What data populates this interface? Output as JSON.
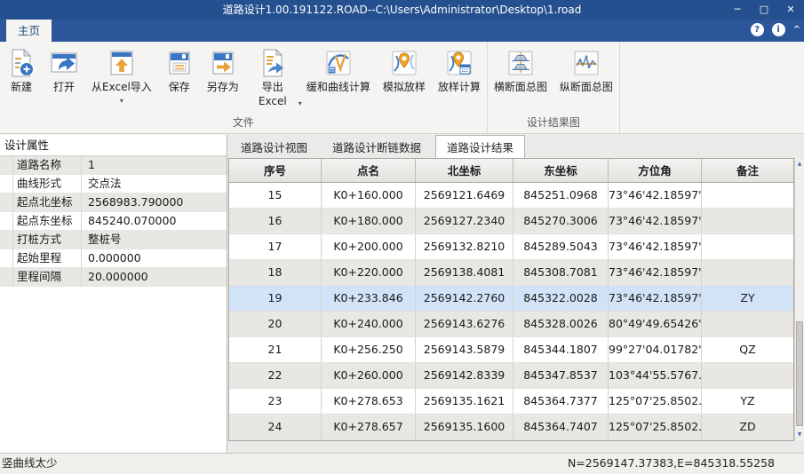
{
  "window": {
    "title": "道路设计1.00.191122.ROAD--C:\\Users\\Administrator\\Desktop\\1.road"
  },
  "icons": {
    "minimize": "─",
    "maximize": "□",
    "close": "✕",
    "help": "?",
    "info": "i",
    "collapse_ribbon": "^",
    "dropdown": "▾",
    "scroll_up": "▲",
    "scroll_down": "▼"
  },
  "colors": {
    "titlebar_blue": "#24508f",
    "ribbon_band_blue": "#2b579a",
    "selected_row": "#d2e3f8",
    "alt_row": "#e9e7e3",
    "accent_orange": "#e8a33d",
    "accent_blue": "#3a76c4"
  },
  "ribbon": {
    "tab": "主页",
    "groups": [
      {
        "label": "文件",
        "buttons": [
          {
            "label": "新建"
          },
          {
            "label": "打开"
          },
          {
            "label": "从Excel导入",
            "dropdown": true
          },
          {
            "label": "保存"
          },
          {
            "label": "另存为"
          },
          {
            "label": "导出Excel",
            "dropdown": true
          },
          {
            "label": "缓和曲线计算"
          },
          {
            "label": "模拟放样"
          },
          {
            "label": "放样计算"
          }
        ]
      },
      {
        "label": "设计结果图",
        "buttons": [
          {
            "label": "横断面总图"
          },
          {
            "label": "纵断面总图"
          }
        ]
      }
    ]
  },
  "properties": {
    "title": "设计属性",
    "rows": [
      {
        "label": "道路名称",
        "value": "1"
      },
      {
        "label": "曲线形式",
        "value": "交点法"
      },
      {
        "label": "起点北坐标",
        "value": "2568983.790000"
      },
      {
        "label": "起点东坐标",
        "value": "845240.070000"
      },
      {
        "label": "打桩方式",
        "value": "整桩号"
      },
      {
        "label": "起始里程",
        "value": "0.000000"
      },
      {
        "label": "里程间隔",
        "value": "20.000000"
      }
    ]
  },
  "view_tabs": [
    {
      "label": "道路设计视图",
      "active": false
    },
    {
      "label": "道路设计断链数据",
      "active": false
    },
    {
      "label": "道路设计结果",
      "active": true
    }
  ],
  "results_table": {
    "columns": [
      "序号",
      "点名",
      "北坐标",
      "东坐标",
      "方位角",
      "备注"
    ],
    "selected_row_index": 4,
    "rows": [
      [
        "15",
        "K0+160.000",
        "2569121.6469",
        "845251.0968",
        "73°46'42.18597\"",
        ""
      ],
      [
        "16",
        "K0+180.000",
        "2569127.2340",
        "845270.3006",
        "73°46'42.18597\"",
        ""
      ],
      [
        "17",
        "K0+200.000",
        "2569132.8210",
        "845289.5043",
        "73°46'42.18597\"",
        ""
      ],
      [
        "18",
        "K0+220.000",
        "2569138.4081",
        "845308.7081",
        "73°46'42.18597\"",
        ""
      ],
      [
        "19",
        "K0+233.846",
        "2569142.2760",
        "845322.0028",
        "73°46'42.18597\"",
        "ZY"
      ],
      [
        "20",
        "K0+240.000",
        "2569143.6276",
        "845328.0026",
        "80°49'49.65426\"",
        ""
      ],
      [
        "21",
        "K0+256.250",
        "2569143.5879",
        "845344.1807",
        "99°27'04.01782\"",
        "QZ"
      ],
      [
        "22",
        "K0+260.000",
        "2569142.8339",
        "845347.8537",
        "103°44'55.5767...",
        ""
      ],
      [
        "23",
        "K0+278.653",
        "2569135.1621",
        "845364.7377",
        "125°07'25.8502...",
        "YZ"
      ],
      [
        "24",
        "K0+278.657",
        "2569135.1600",
        "845364.7407",
        "125°07'25.8502...",
        "ZD"
      ]
    ]
  },
  "status": {
    "left": "竖曲线太少",
    "right": "N=2569147.37383,E=845318.55258"
  }
}
